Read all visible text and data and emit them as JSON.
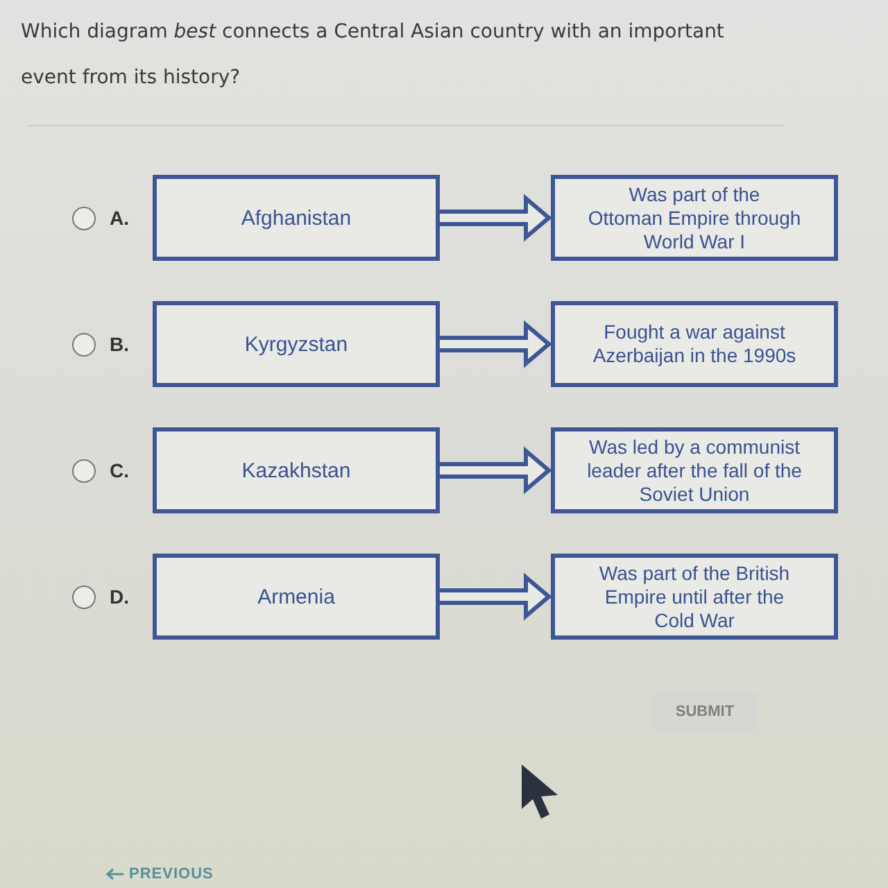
{
  "question": {
    "text": "Which diagram *best* connects a Central Asian country with an important event from its history?"
  },
  "options": [
    {
      "letter": "A.",
      "selected": false,
      "country": "Afghanistan",
      "event": "Was part of the\nOttoman Empire through\nWorld War I"
    },
    {
      "letter": "B.",
      "selected": false,
      "country": "Kyrgyzstan",
      "event": "Fought a war against\nAzerbaijan in the 1990s"
    },
    {
      "letter": "C.",
      "selected": false,
      "country": "Kazakhstan",
      "event": "Was led by a communist\nleader after the fall of the\nSoviet Union"
    },
    {
      "letter": "D.",
      "selected": false,
      "country": "Armenia",
      "event": "Was part of the British\nEmpire until after the\nCold War"
    }
  ],
  "submit": {
    "label": "SUBMIT",
    "disabled": true
  },
  "previous": {
    "label": "PREVIOUS"
  }
}
